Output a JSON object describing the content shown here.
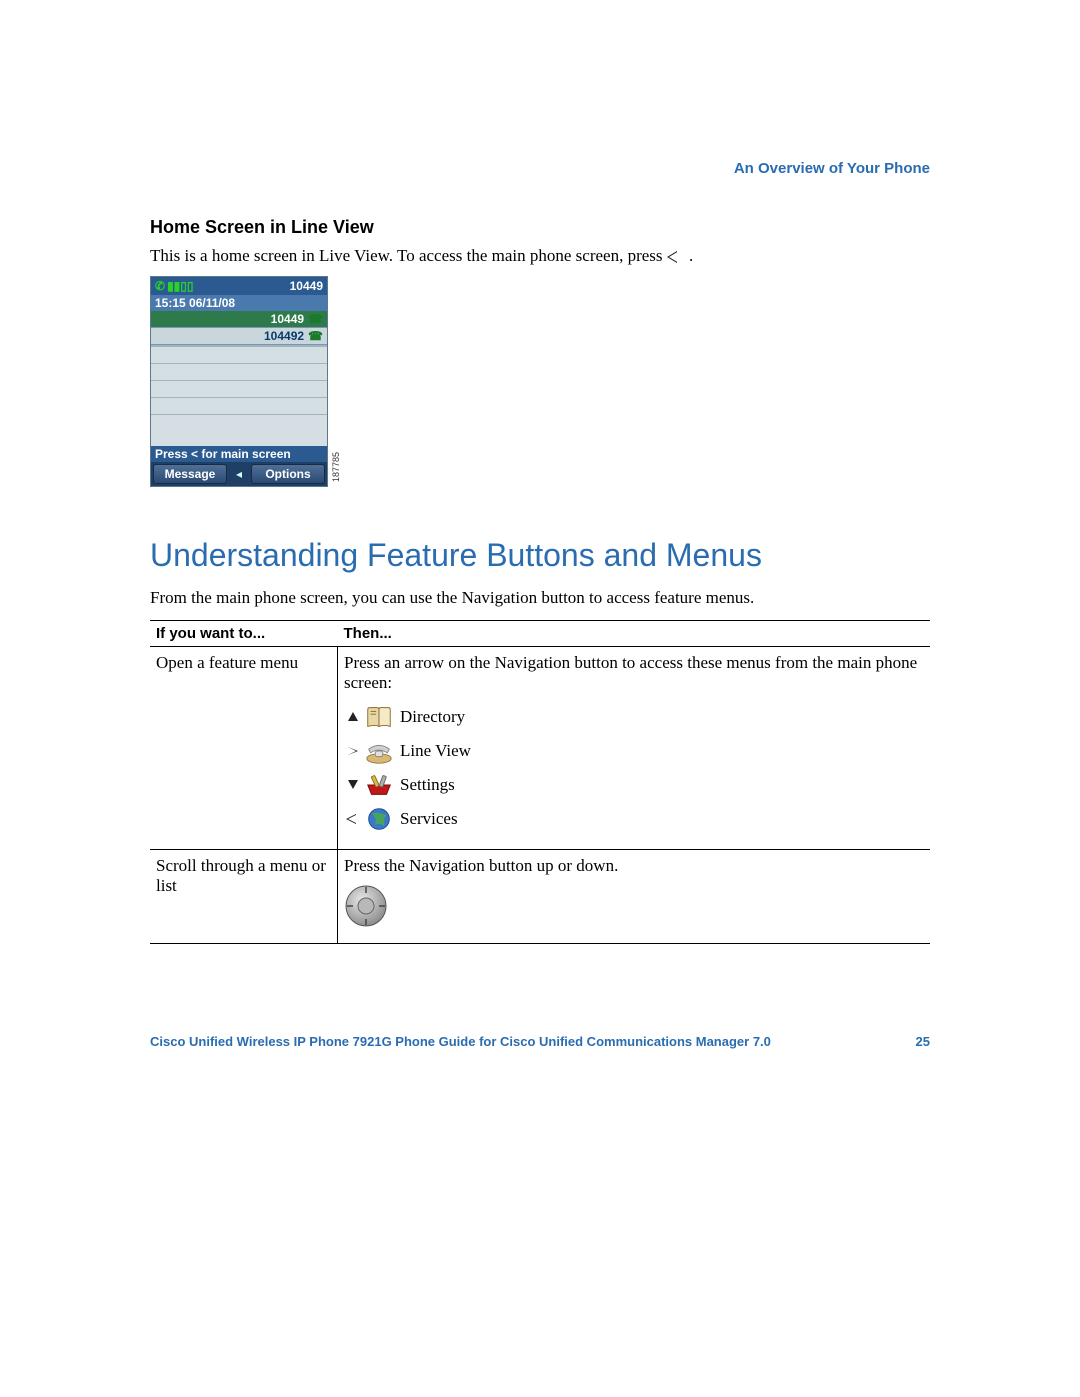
{
  "header": {
    "chapter_title": "An Overview of Your Phone"
  },
  "section1": {
    "heading": "Home Screen in Line View",
    "intro_prefix": "This is a home screen in Live View. To access the main phone screen, press ",
    "intro_suffix": " ."
  },
  "phone_screenshot": {
    "status_number": "10449",
    "datetime": "15:15 06/11/08",
    "line1_number": "10449",
    "line2_number": "104492",
    "hint": "Press < for main screen",
    "softkey_left": "Message",
    "softkey_right": "Options",
    "figure_id": "187785"
  },
  "section2": {
    "heading": "Understanding Feature Buttons and Menus",
    "intro": "From the main phone screen, you can use the Navigation button to access feature menus."
  },
  "table": {
    "col1_header": "If you want to...",
    "col2_header": "Then...",
    "rows": [
      {
        "col1": "Open a feature menu",
        "col2_intro": "Press an arrow on the Navigation button to access these menus from the main phone screen:",
        "menu_items": [
          {
            "label": "Directory",
            "arrow": "up",
            "icon": "directory-icon"
          },
          {
            "label": "Line View",
            "arrow": "right",
            "icon": "lineview-icon"
          },
          {
            "label": "Settings",
            "arrow": "down",
            "icon": "settings-icon"
          },
          {
            "label": "Services",
            "arrow": "left",
            "icon": "services-icon"
          }
        ]
      },
      {
        "col1": "Scroll through a menu or list",
        "col2_intro": "Press the Navigation button up or down."
      }
    ]
  },
  "footer": {
    "doc_title": "Cisco Unified Wireless IP Phone 7921G Phone Guide for Cisco Unified Communications Manager 7.0",
    "page_number": "25"
  }
}
